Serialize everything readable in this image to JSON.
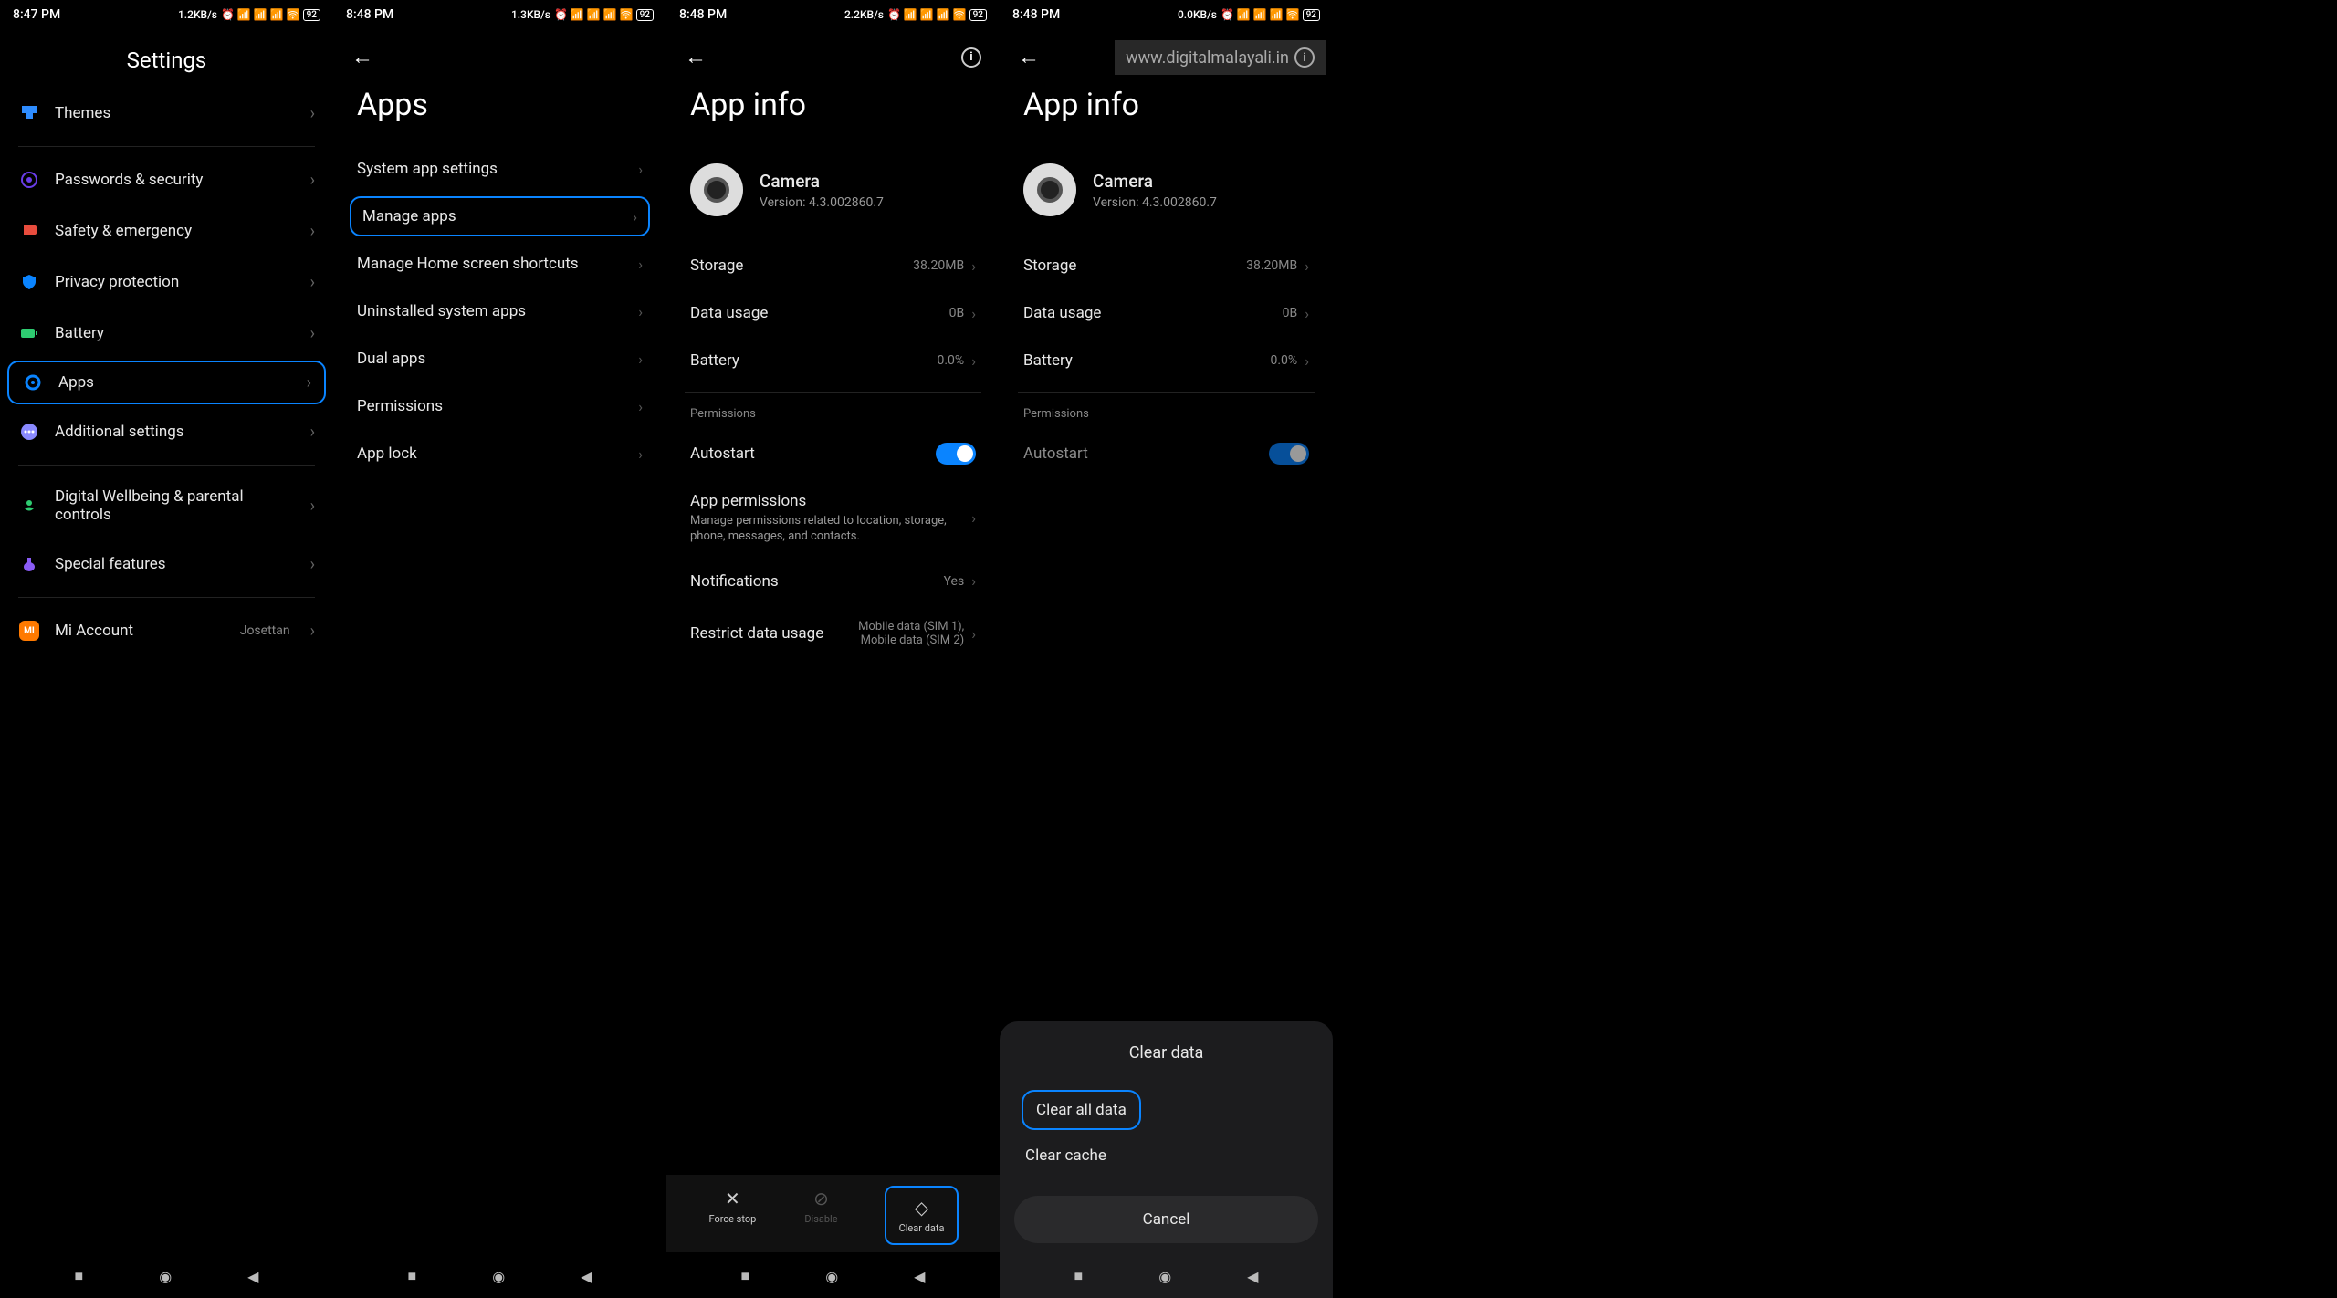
{
  "screens": [
    {
      "status": {
        "time": "8:47 PM",
        "speed": "1.2KB/s",
        "battery": "92"
      },
      "title": "Settings",
      "items": [
        {
          "icon": "themes",
          "color": "#2e8cff",
          "label": "Themes"
        },
        {
          "divider": true
        },
        {
          "icon": "lock",
          "color": "#6a3de8",
          "label": "Passwords & security"
        },
        {
          "icon": "alert",
          "color": "#e84c3d",
          "label": "Safety & emergency"
        },
        {
          "icon": "shield",
          "color": "#0a84ff",
          "label": "Privacy protection"
        },
        {
          "icon": "battery",
          "color": "#2ecc71",
          "label": "Battery"
        },
        {
          "icon": "gear",
          "color": "#0a84ff",
          "label": "Apps",
          "highlighted": true
        },
        {
          "icon": "dots",
          "color": "#8a8aff",
          "label": "Additional settings"
        },
        {
          "divider": true
        },
        {
          "icon": "heart",
          "color": "#2ecc71",
          "label": "Digital Wellbeing & parental controls"
        },
        {
          "icon": "flask",
          "color": "#8a5cf6",
          "label": "Special features"
        },
        {
          "divider": true
        },
        {
          "icon": "mi",
          "color": "#ff7a00",
          "label": "Mi Account",
          "value": "Josettan"
        }
      ]
    },
    {
      "status": {
        "time": "8:48 PM",
        "speed": "1.3KB/s",
        "battery": "92"
      },
      "title": "Apps",
      "items": [
        {
          "label": "System app settings"
        },
        {
          "label": "Manage apps",
          "highlighted": true
        },
        {
          "label": "Manage Home screen shortcuts"
        },
        {
          "label": "Uninstalled system apps"
        },
        {
          "label": "Dual apps"
        },
        {
          "label": "Permissions"
        },
        {
          "label": "App lock"
        }
      ]
    },
    {
      "status": {
        "time": "8:48 PM",
        "speed": "2.2KB/s",
        "battery": "92"
      },
      "title": "App info",
      "app": {
        "name": "Camera",
        "version": "Version: 4.3.002860.7"
      },
      "rows": [
        {
          "label": "Storage",
          "value": "38.20MB"
        },
        {
          "label": "Data usage",
          "value": "0B"
        },
        {
          "label": "Battery",
          "value": "0.0%"
        }
      ],
      "permHeader": "Permissions",
      "autostart": "Autostart",
      "appPerms": {
        "title": "App permissions",
        "desc": "Manage permissions related to location, storage, phone, messages, and contacts."
      },
      "notifications": {
        "label": "Notifications",
        "value": "Yes"
      },
      "restrict": {
        "label": "Restrict data usage",
        "value1": "Mobile data (SIM 1),",
        "value2": "Mobile data (SIM 2)"
      },
      "bottomBtns": [
        {
          "icon": "✕",
          "label": "Force stop"
        },
        {
          "icon": "⊘",
          "label": "Disable",
          "disabled": true
        },
        {
          "icon": "◇",
          "label": "Clear data",
          "highlighted": true
        }
      ]
    },
    {
      "status": {
        "time": "8:48 PM",
        "speed": "0.0KB/s",
        "battery": "92"
      },
      "title": "App info",
      "watermark": "www.digitalmalayali.in",
      "app": {
        "name": "Camera",
        "version": "Version: 4.3.002860.7"
      },
      "rows": [
        {
          "label": "Storage",
          "value": "38.20MB"
        },
        {
          "label": "Data usage",
          "value": "0B"
        },
        {
          "label": "Battery",
          "value": "0.0%"
        }
      ],
      "permHeader": "Permissions",
      "autostart": "Autostart",
      "dialog": {
        "title": "Clear data",
        "options": [
          "Clear all data",
          "Clear cache"
        ],
        "cancel": "Cancel"
      }
    }
  ]
}
